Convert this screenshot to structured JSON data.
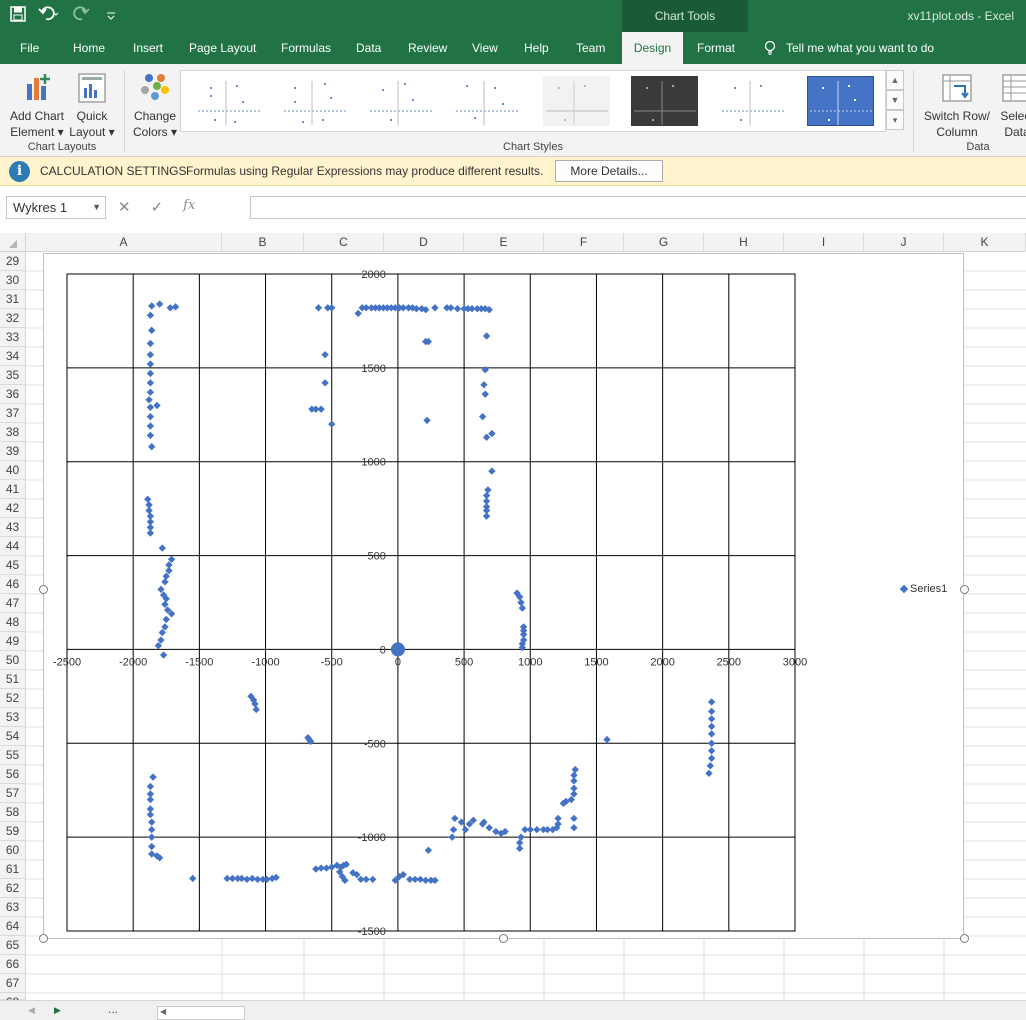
{
  "title_bar": {
    "chart_tools_label": "Chart Tools",
    "document_title": "xv11plot.ods  -  Excel",
    "qat": [
      "save-icon",
      "undo-icon",
      "redo-icon",
      "customize-icon"
    ]
  },
  "tabs": [
    {
      "label": "File"
    },
    {
      "label": "Home"
    },
    {
      "label": "Insert"
    },
    {
      "label": "Page Layout"
    },
    {
      "label": "Formulas"
    },
    {
      "label": "Data"
    },
    {
      "label": "Review"
    },
    {
      "label": "View"
    },
    {
      "label": "Help"
    },
    {
      "label": "Team"
    },
    {
      "label": "Design",
      "active": true
    },
    {
      "label": "Format"
    }
  ],
  "tell_me": "Tell me what you want to do",
  "ribbon": {
    "add_chart_element": [
      "Add Chart",
      "Element"
    ],
    "quick_layout": [
      "Quick",
      "Layout"
    ],
    "change_colors": [
      "Change",
      "Colors"
    ],
    "switch_row_column": [
      "Switch Row/",
      "Column"
    ],
    "select_data": [
      "Select",
      "Data"
    ],
    "group_chart_layouts": "Chart Layouts",
    "group_chart_styles": "Chart Styles",
    "group_data": "Data"
  },
  "message_bar": {
    "title": "CALCULATION SETTINGS",
    "text": "Formulas using Regular Expressions may produce different results.",
    "button": "More Details..."
  },
  "formula_bar": {
    "name_box": "Wykres 1",
    "fx": "fx",
    "value": ""
  },
  "columns": [
    "A",
    "B",
    "C",
    "D",
    "E",
    "F",
    "G",
    "H",
    "I",
    "J",
    "K"
  ],
  "rows": [
    "29",
    "30",
    "31",
    "32",
    "33",
    "34",
    "35",
    "36",
    "37",
    "38",
    "39",
    "40",
    "41",
    "42",
    "43",
    "44",
    "45",
    "46",
    "47",
    "48",
    "49",
    "50",
    "51",
    "52",
    "53",
    "54",
    "55",
    "56",
    "57",
    "58",
    "59",
    "60",
    "61",
    "62",
    "63",
    "64",
    "65",
    "66",
    "67",
    "68"
  ],
  "colors": {
    "excel_green": "#217346",
    "series": "#4472c4"
  },
  "chart_data": {
    "type": "scatter",
    "title": "",
    "xlabel": "",
    "ylabel": "",
    "xlim": [
      -2500,
      3000
    ],
    "ylim": [
      -1500,
      2000
    ],
    "x_ticks": [
      "-2500",
      "-2000",
      "-1500",
      "-1000",
      "-500",
      "0",
      "500",
      "1000",
      "1500",
      "2000",
      "2500",
      "3000"
    ],
    "y_ticks": [
      "2000",
      "1500",
      "1000",
      "500",
      "0",
      "-500",
      "-1000",
      "-1500"
    ],
    "grid": true,
    "legend": "right",
    "series": [
      {
        "name": "Series1",
        "points": [
          [
            -1860,
            1830
          ],
          [
            -1800,
            1840
          ],
          [
            -1720,
            1820
          ],
          [
            -1680,
            1825
          ],
          [
            -1870,
            1780
          ],
          [
            -1860,
            1700
          ],
          [
            -1870,
            1630
          ],
          [
            -1870,
            1570
          ],
          [
            -1870,
            1520
          ],
          [
            -1870,
            1470
          ],
          [
            -1870,
            1420
          ],
          [
            -1870,
            1370
          ],
          [
            -1880,
            1330
          ],
          [
            -1870,
            1290
          ],
          [
            -1820,
            1300
          ],
          [
            -1870,
            1240
          ],
          [
            -1870,
            1190
          ],
          [
            -1870,
            1140
          ],
          [
            -1860,
            1080
          ],
          [
            -1890,
            800
          ],
          [
            -1880,
            770
          ],
          [
            -1880,
            740
          ],
          [
            -1870,
            710
          ],
          [
            -1870,
            680
          ],
          [
            -1870,
            650
          ],
          [
            -1870,
            620
          ],
          [
            -1780,
            540
          ],
          [
            -1710,
            480
          ],
          [
            -1730,
            450
          ],
          [
            -1730,
            420
          ],
          [
            -1750,
            390
          ],
          [
            -1760,
            360
          ],
          [
            -1790,
            320
          ],
          [
            -1770,
            290
          ],
          [
            -1750,
            270
          ],
          [
            -1760,
            240
          ],
          [
            -1740,
            210
          ],
          [
            -1710,
            190
          ],
          [
            -1750,
            160
          ],
          [
            -1760,
            120
          ],
          [
            -1780,
            90
          ],
          [
            -1790,
            50
          ],
          [
            -1810,
            20
          ],
          [
            -1770,
            -30
          ],
          [
            -600,
            1820
          ],
          [
            -530,
            1820
          ],
          [
            -500,
            1820
          ],
          [
            -300,
            1790
          ],
          [
            -270,
            1820
          ],
          [
            -240,
            1820
          ],
          [
            -200,
            1820
          ],
          [
            -170,
            1820
          ],
          [
            -140,
            1820
          ],
          [
            -110,
            1820
          ],
          [
            -80,
            1820
          ],
          [
            -50,
            1820
          ],
          [
            -20,
            1820
          ],
          [
            10,
            1820
          ],
          [
            40,
            1820
          ],
          [
            80,
            1820
          ],
          [
            110,
            1820
          ],
          [
            140,
            1815
          ],
          [
            180,
            1815
          ],
          [
            210,
            1810
          ],
          [
            280,
            1820
          ],
          [
            370,
            1820
          ],
          [
            400,
            1820
          ],
          [
            450,
            1815
          ],
          [
            500,
            1815
          ],
          [
            530,
            1815
          ],
          [
            560,
            1815
          ],
          [
            600,
            1815
          ],
          [
            630,
            1815
          ],
          [
            660,
            1815
          ],
          [
            690,
            1810
          ],
          [
            -550,
            1570
          ],
          [
            -550,
            1420
          ],
          [
            -580,
            1280
          ],
          [
            -620,
            1280
          ],
          [
            -650,
            1280
          ],
          [
            -500,
            1200
          ],
          [
            210,
            1640
          ],
          [
            230,
            1640
          ],
          [
            220,
            1220
          ],
          [
            670,
            1670
          ],
          [
            660,
            1490
          ],
          [
            650,
            1410
          ],
          [
            660,
            1360
          ],
          [
            640,
            1240
          ],
          [
            670,
            1130
          ],
          [
            710,
            1150
          ],
          [
            710,
            950
          ],
          [
            680,
            850
          ],
          [
            670,
            820
          ],
          [
            670,
            790
          ],
          [
            670,
            760
          ],
          [
            670,
            740
          ],
          [
            670,
            710
          ],
          [
            900,
            300
          ],
          [
            920,
            280
          ],
          [
            930,
            250
          ],
          [
            940,
            220
          ],
          [
            950,
            120
          ],
          [
            950,
            100
          ],
          [
            950,
            80
          ],
          [
            950,
            50
          ],
          [
            940,
            30
          ],
          [
            940,
            10
          ],
          [
            -1110,
            -250
          ],
          [
            -1090,
            -270
          ],
          [
            -1080,
            -290
          ],
          [
            -1070,
            -320
          ],
          [
            -680,
            -470
          ],
          [
            -670,
            -480
          ],
          [
            -660,
            -490
          ],
          [
            -1850,
            -680
          ],
          [
            -1870,
            -730
          ],
          [
            -1870,
            -770
          ],
          [
            -1870,
            -800
          ],
          [
            -1870,
            -850
          ],
          [
            -1870,
            -880
          ],
          [
            -1860,
            -920
          ],
          [
            -1860,
            -960
          ],
          [
            -1860,
            -1000
          ],
          [
            -1860,
            -1050
          ],
          [
            -1860,
            -1090
          ],
          [
            -1820,
            -1100
          ],
          [
            -1800,
            -1110
          ],
          [
            -1550,
            -1220
          ],
          [
            -1290,
            -1220
          ],
          [
            -1250,
            -1220
          ],
          [
            -1210,
            -1220
          ],
          [
            -1180,
            -1220
          ],
          [
            -1140,
            -1225
          ],
          [
            -1100,
            -1220
          ],
          [
            -1060,
            -1225
          ],
          [
            -1020,
            -1225
          ],
          [
            -990,
            -1225
          ],
          [
            -950,
            -1220
          ],
          [
            -920,
            -1215
          ],
          [
            -620,
            -1170
          ],
          [
            -580,
            -1165
          ],
          [
            -540,
            -1165
          ],
          [
            -500,
            -1160
          ],
          [
            -460,
            -1150
          ],
          [
            -430,
            -1160
          ],
          [
            -410,
            -1150
          ],
          [
            -390,
            -1145
          ],
          [
            -440,
            -1185
          ],
          [
            -420,
            -1210
          ],
          [
            -400,
            -1230
          ],
          [
            -340,
            -1190
          ],
          [
            -310,
            -1200
          ],
          [
            -280,
            -1225
          ],
          [
            -240,
            -1225
          ],
          [
            -190,
            -1225
          ],
          [
            -20,
            -1230
          ],
          [
            10,
            -1210
          ],
          [
            40,
            -1200
          ],
          [
            90,
            -1225
          ],
          [
            130,
            -1225
          ],
          [
            170,
            -1225
          ],
          [
            210,
            -1230
          ],
          [
            250,
            -1230
          ],
          [
            280,
            -1230
          ],
          [
            230,
            -1070
          ],
          [
            410,
            -1000
          ],
          [
            420,
            -960
          ],
          [
            430,
            -900
          ],
          [
            480,
            -920
          ],
          [
            510,
            -960
          ],
          [
            540,
            -930
          ],
          [
            570,
            -910
          ],
          [
            640,
            -930
          ],
          [
            650,
            -920
          ],
          [
            690,
            -950
          ],
          [
            740,
            -970
          ],
          [
            780,
            -980
          ],
          [
            810,
            -970
          ],
          [
            930,
            -1000
          ],
          [
            920,
            -1030
          ],
          [
            920,
            -1060
          ],
          [
            960,
            -960
          ],
          [
            1000,
            -960
          ],
          [
            1050,
            -960
          ],
          [
            1100,
            -960
          ],
          [
            1130,
            -960
          ],
          [
            1170,
            -960
          ],
          [
            1200,
            -950
          ],
          [
            1210,
            -930
          ],
          [
            1210,
            -900
          ],
          [
            1330,
            -900
          ],
          [
            1330,
            -950
          ],
          [
            1250,
            -820
          ],
          [
            1270,
            -810
          ],
          [
            1310,
            -800
          ],
          [
            1330,
            -770
          ],
          [
            1330,
            -740
          ],
          [
            1330,
            -700
          ],
          [
            1330,
            -670
          ],
          [
            1340,
            -640
          ],
          [
            1580,
            -480
          ],
          [
            2370,
            -280
          ],
          [
            2370,
            -330
          ],
          [
            2370,
            -370
          ],
          [
            2370,
            -410
          ],
          [
            2370,
            -450
          ],
          [
            2370,
            -500
          ],
          [
            2370,
            -540
          ],
          [
            2370,
            -580
          ],
          [
            2360,
            -620
          ],
          [
            2350,
            -660
          ]
        ]
      }
    ],
    "highlight_point": [
      0,
      0
    ]
  }
}
